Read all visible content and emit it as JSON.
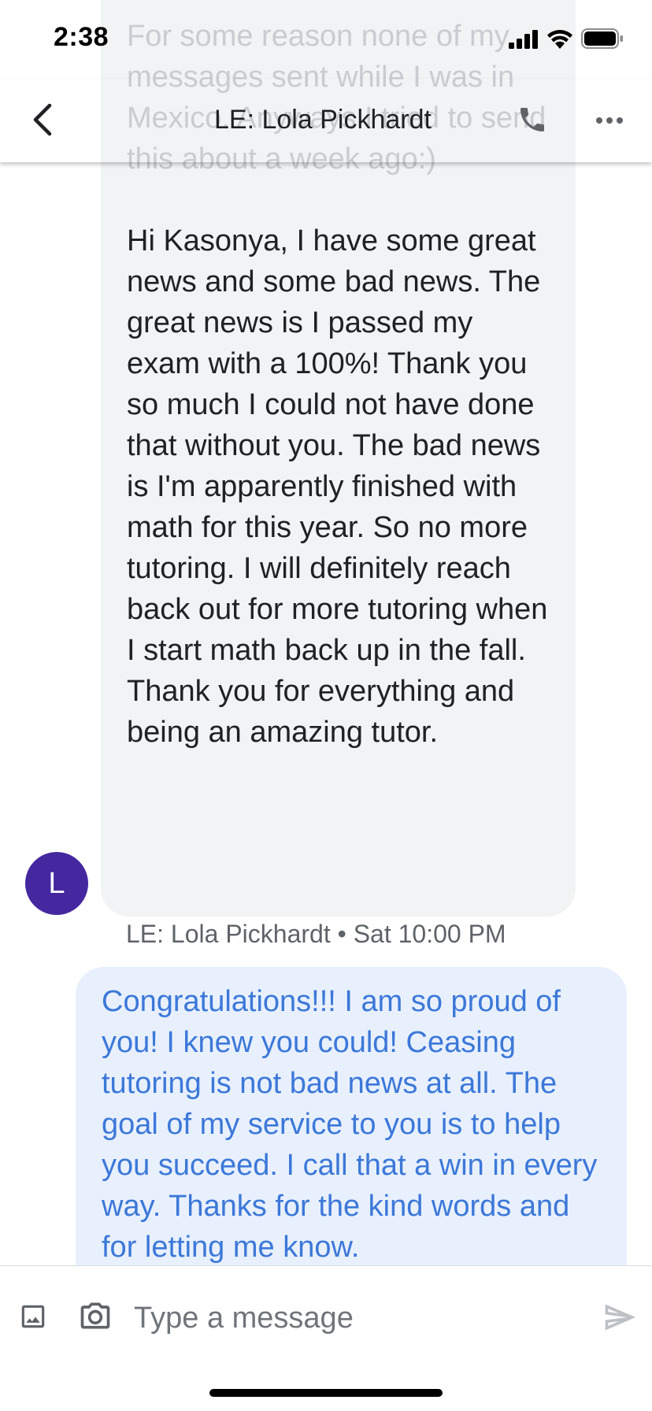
{
  "status_bar": {
    "time": "2:38"
  },
  "header": {
    "title": "LE: Lola Pickhardt",
    "back_icon": "chevron-left-icon",
    "call_icon": "phone-icon",
    "more_icon": "more-horizontal-icon"
  },
  "conversation": {
    "incoming": {
      "faded_text": "For some reason none of my messages sent while I was in Mexico. Anyways I tried to send this about a week ago:)",
      "text": "Hi Kasonya, I have some great news and some bad news. The great news is I passed my exam with a 100%! Thank you so much I could not have done that without you. The bad news is I'm apparently finished with math for this year. So no more tutoring. I will definitely reach back out for more tutoring when I start math back up in the fall. Thank you for everything and being an amazing tutor.",
      "avatar_initial": "L",
      "sender": "LE: Lola Pickhardt",
      "separator": "•",
      "timestamp": "Sat 10:00 PM"
    },
    "outgoing": {
      "text": "Congratulations!!! I am so proud of you! I knew you could! Ceasing tutoring is not bad news at all. The goal of my service to you is to help you succeed. I call that a win in every way. Thanks for the kind words and for letting me know."
    }
  },
  "composer": {
    "placeholder": "Type a message",
    "value": ""
  },
  "colors": {
    "avatar": "#4527a0",
    "incoming_bubble": "#f1f3f4",
    "outgoing_bubble": "#e8f0fe",
    "outgoing_text": "#3c78d8"
  }
}
